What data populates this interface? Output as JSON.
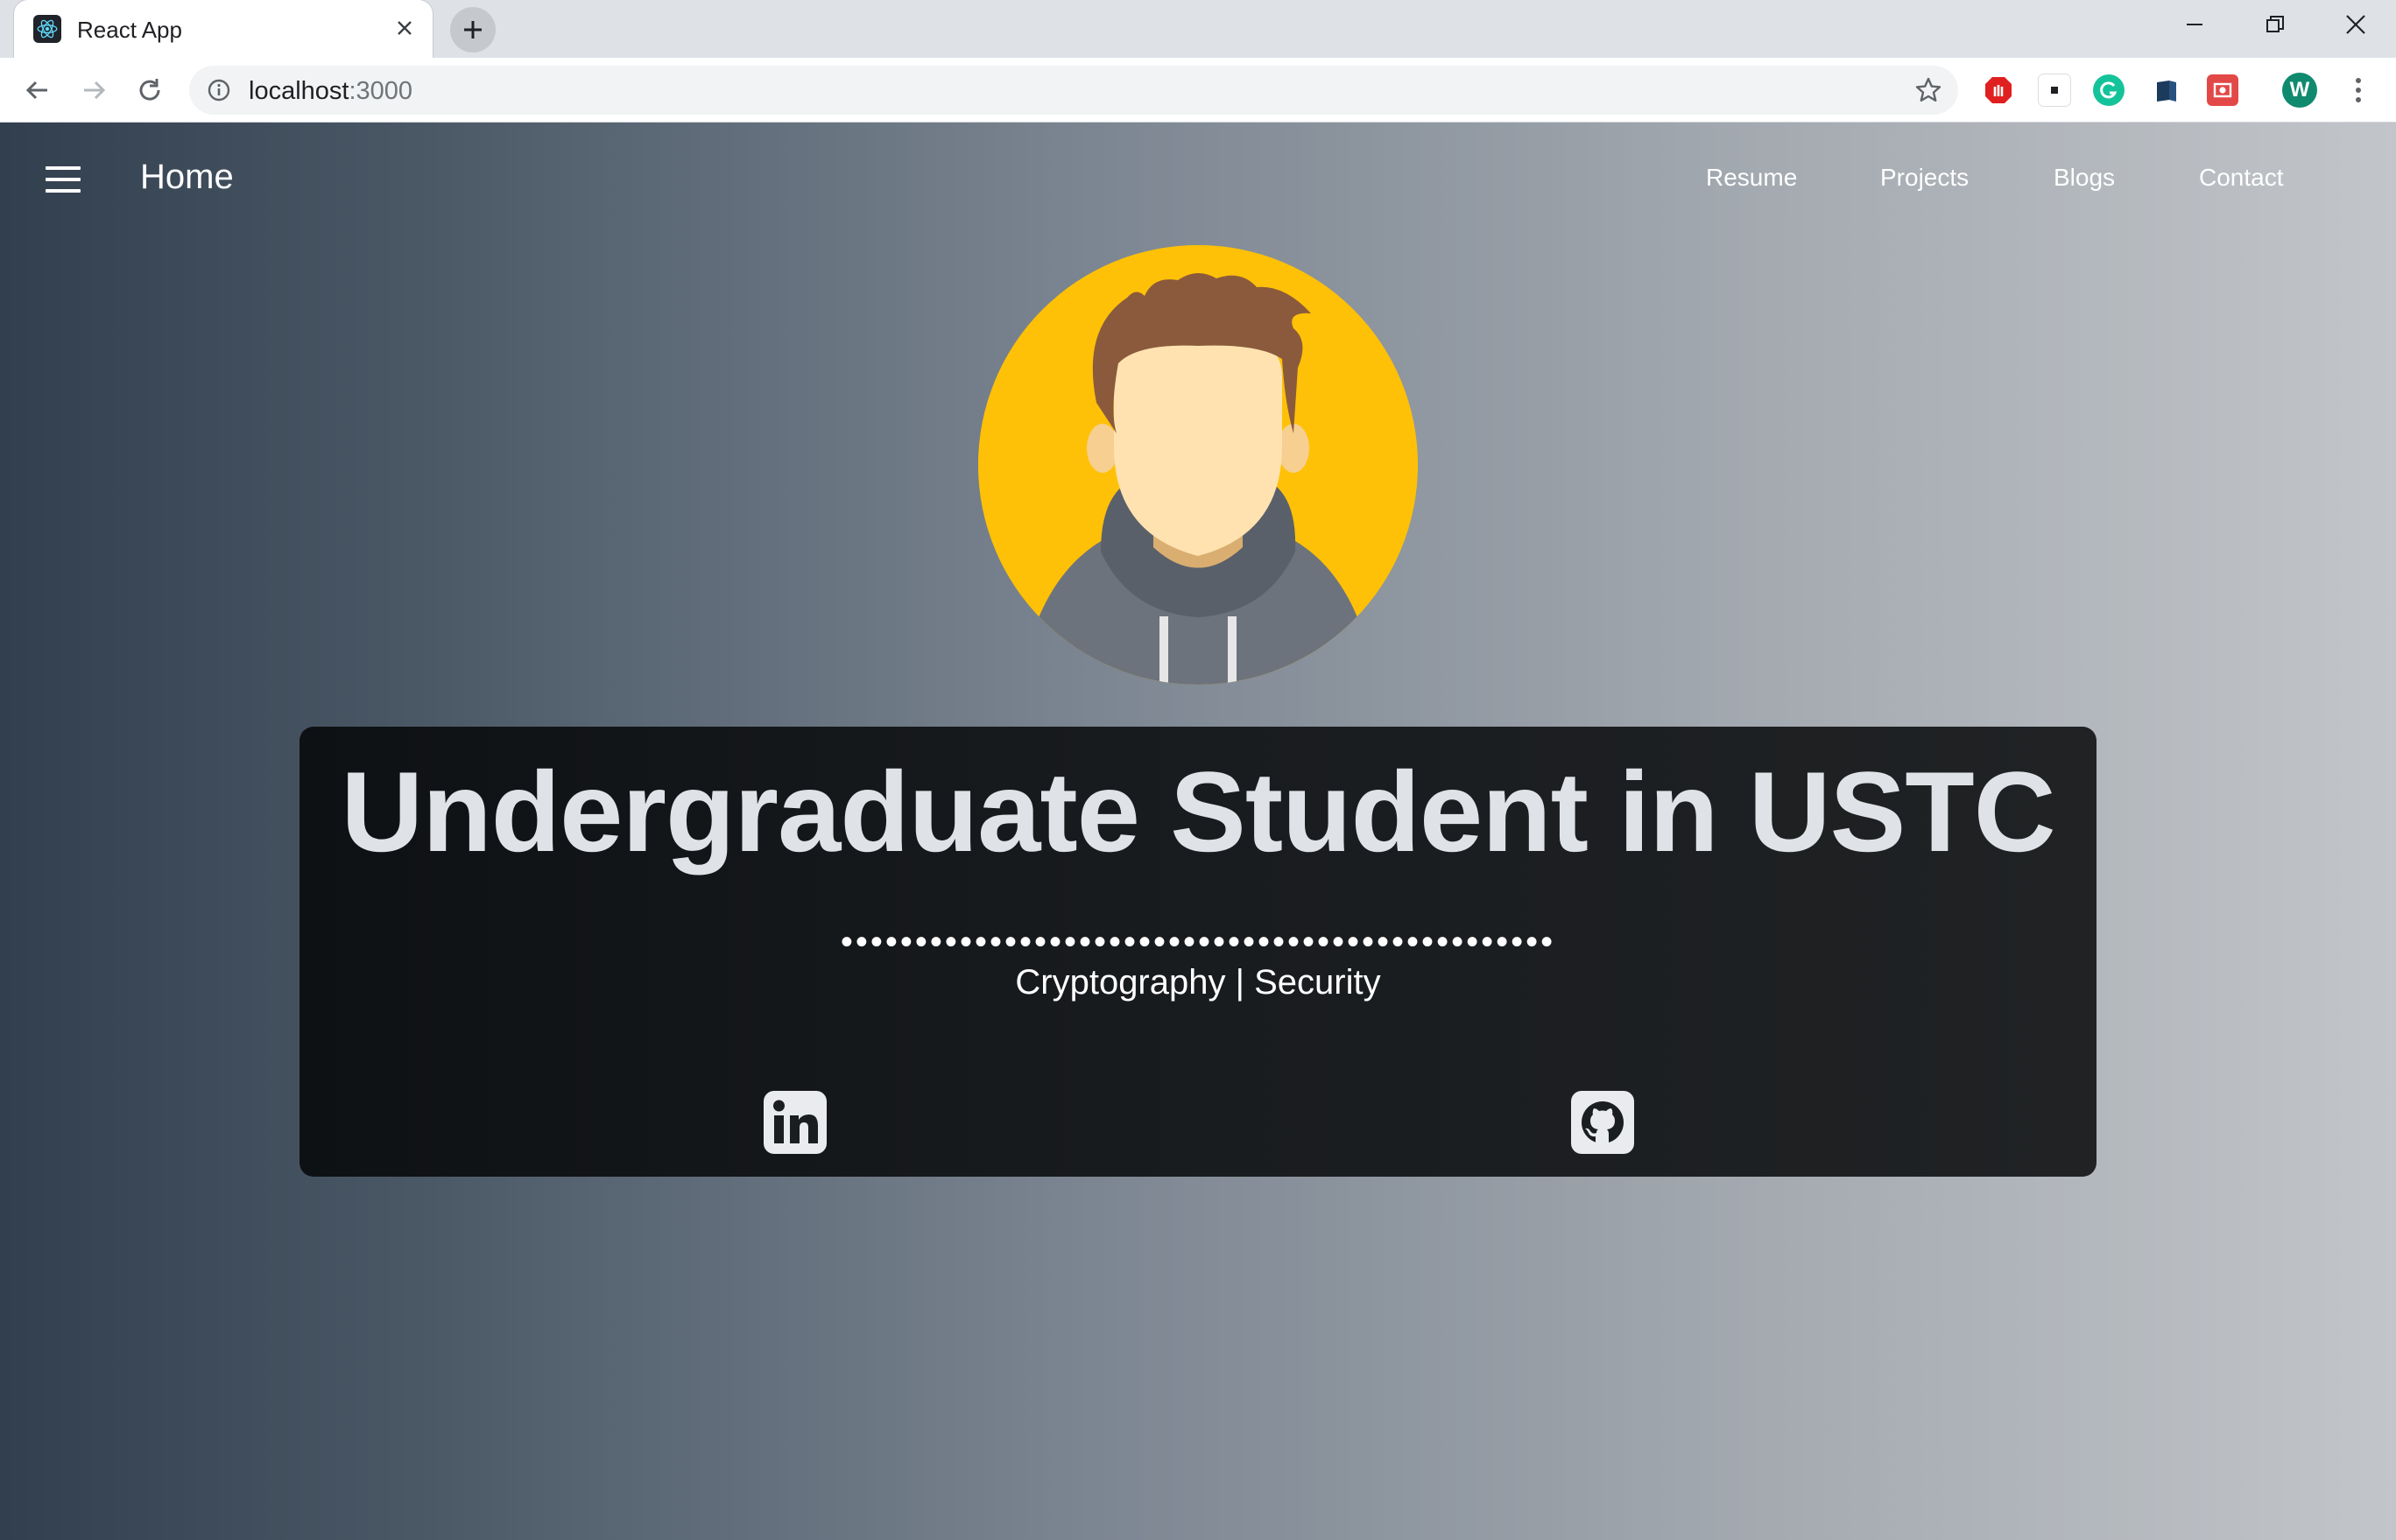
{
  "browser": {
    "tab_title": "React App",
    "url_host": "localhost",
    "url_port": ":3000",
    "profile_initial": "W"
  },
  "navbar": {
    "home_label": "Home",
    "links": [
      "Resume",
      "Projects",
      "Blogs",
      "Contact"
    ]
  },
  "hero": {
    "title": "Undergraduate Student in USTC",
    "dots": "••••••••••••••••••••••••••••••••••••••••••••••••",
    "subtitle": "Cryptography | Security"
  },
  "social": {
    "linkedin_icon": "linkedin-icon",
    "github_icon": "github-icon"
  },
  "colors": {
    "avatar_background": "#ffc107",
    "card_background": "#1a1d20",
    "accent_profile": "#0f8a6f"
  }
}
